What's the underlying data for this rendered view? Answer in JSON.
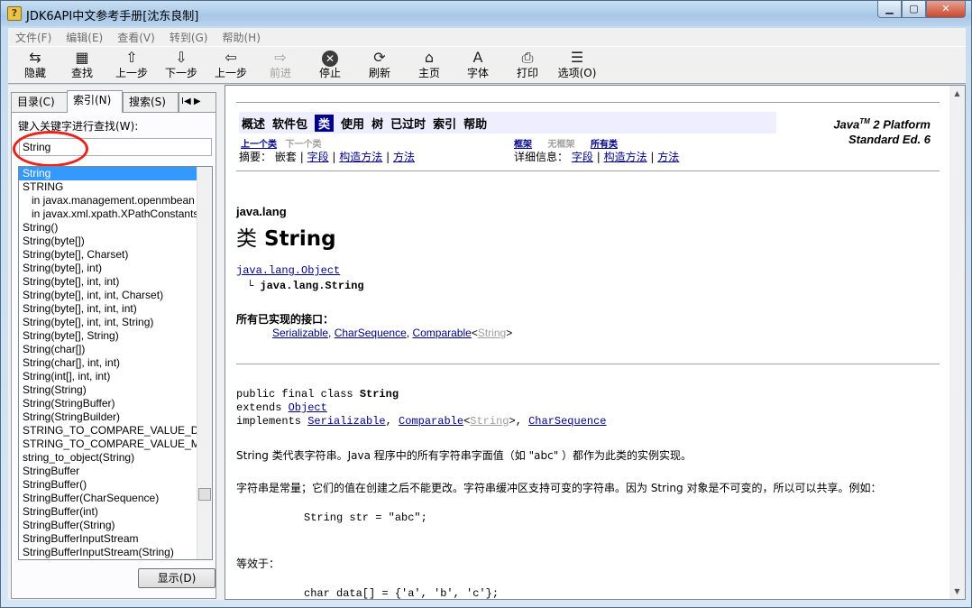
{
  "window": {
    "title": "JDK6API中文参考手册[沈东良制]",
    "buttons": {
      "minimize": "▁",
      "maximize": "▢",
      "close": "✕"
    }
  },
  "menu": [
    "文件(F)",
    "编辑(E)",
    "查看(V)",
    "转到(G)",
    "帮助(H)"
  ],
  "toolbar": [
    {
      "label": "隐藏",
      "icon": "hide-icon",
      "glyph": "⇆"
    },
    {
      "label": "查找",
      "icon": "find-icon",
      "glyph": "▦"
    },
    {
      "label": "上一步",
      "icon": "up-arrow-icon",
      "glyph": "⇧"
    },
    {
      "label": "下一步",
      "icon": "down-arrow-icon",
      "glyph": "⇩"
    },
    {
      "label": "上一步",
      "icon": "back-arrow-icon",
      "glyph": "⇦"
    },
    {
      "label": "前进",
      "icon": "forward-arrow-icon",
      "glyph": "⇨",
      "disabled": true
    },
    {
      "label": "停止",
      "icon": "stop-icon",
      "glyph": "✕"
    },
    {
      "label": "刷新",
      "icon": "refresh-icon",
      "glyph": "⟳"
    },
    {
      "label": "主页",
      "icon": "home-icon",
      "glyph": "⌂"
    },
    {
      "label": "字体",
      "icon": "font-icon",
      "glyph": "A"
    },
    {
      "label": "打印",
      "icon": "print-icon",
      "glyph": "⎙"
    },
    {
      "label": "选项(O)",
      "icon": "options-icon",
      "glyph": "☰"
    }
  ],
  "tabs": {
    "contents": "目录(C)",
    "index": "索引(N)",
    "search": "搜索(S)",
    "nav": "I◀ ▶"
  },
  "index": {
    "label": "键入关键字进行查找(W):",
    "value": "String",
    "show_button": "显示(D)",
    "items": [
      "String",
      "STRING",
      "in javax.management.openmbean",
      "in javax.xml.xpath.XPathConstants",
      "String()",
      "String(byte[])",
      "String(byte[], Charset)",
      "String(byte[], int)",
      "String(byte[], int, int)",
      "String(byte[], int, int, Charset)",
      "String(byte[], int, int, int)",
      "String(byte[], int, int, String)",
      "String(byte[], String)",
      "String(char[])",
      "String(char[], int, int)",
      "String(int[], int, int)",
      "String(String)",
      "String(StringBuffer)",
      "String(StringBuilder)",
      "STRING_TO_COMPARE_VALUE_D",
      "STRING_TO_COMPARE_VALUE_M",
      "string_to_object(String)",
      "StringBuffer",
      "StringBuffer()",
      "StringBuffer(CharSequence)",
      "StringBuffer(int)",
      "StringBuffer(String)",
      "StringBufferInputStream",
      "StringBufferInputStream(String)"
    ]
  },
  "doc": {
    "nav": [
      "概述",
      "软件包",
      "类",
      "使用",
      "树",
      "已过时",
      "索引",
      "帮助"
    ],
    "platform_line1_pre": "Java",
    "platform_tm": "TM",
    "platform_line1_post": " 2 Platform",
    "platform_line2": "Standard Ed. 6",
    "prev_class": "上一个类",
    "next_class": "下一个类",
    "frames": "框架",
    "no_frames": "无框架",
    "all_classes": "所有类",
    "summary_label": "摘要：",
    "nested": "嵌套",
    "field": "字段",
    "constructor": "构造方法",
    "method": "方法",
    "detail_label": "详细信息：",
    "sep": "|",
    "package": "java.lang",
    "class_prefix": "类",
    "class_name": "String",
    "hier_parent": "java.lang.Object",
    "hier_child_prefix": "└",
    "hier_child": "java.lang.String",
    "interfaces_label": "所有已实现的接口：",
    "interfaces": {
      "i1": "Serializable",
      "i2": "CharSequence",
      "i3": "Comparable",
      "lt": "<",
      "gen": "String",
      "gt": ">"
    },
    "decl": {
      "line1_pre": "public final class ",
      "line1_name": "String",
      "line2_pre": "extends ",
      "line2_link": "Object",
      "line3_pre": "implements ",
      "impl1": "Serializable",
      "impl2": "Comparable",
      "impl_lt": "<",
      "impl_gen": "String",
      "impl_gt": ">",
      "impl3": "CharSequence",
      "comma": ", "
    },
    "para1": "String 类代表字符串。Java 程序中的所有字符串字面值（如 \"abc\" ）都作为此类的实例实现。",
    "para2": "字符串是常量；它们的值在创建之后不能更改。字符串缓冲区支持可变的字符串。因为 String 对象是不可变的，所以可以共享。例如：",
    "code1": "String str = \"abc\";",
    "para3": "等效于：",
    "code2": "char data[] = {'a', 'b', 'c'};"
  }
}
